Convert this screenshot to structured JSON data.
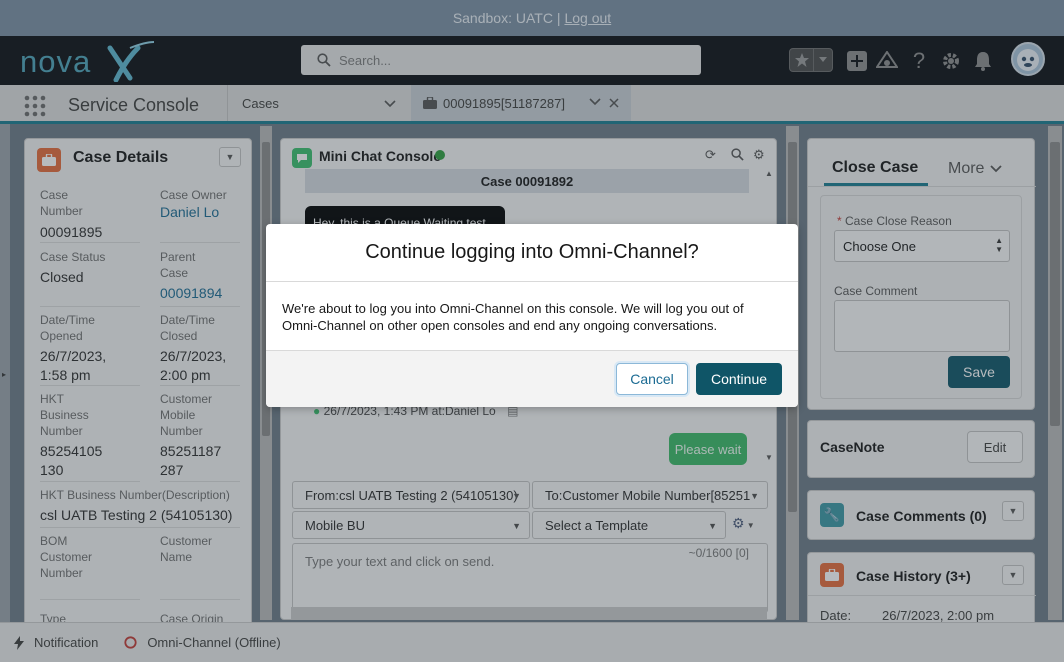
{
  "sandbox": {
    "text": "Sandbox: UATC |",
    "logout": "Log out"
  },
  "brand": {
    "logo_text": "novaX",
    "accent": "#1a7b90"
  },
  "search": {
    "placeholder": "Search..."
  },
  "app": {
    "name": "Service Console"
  },
  "nav": {
    "object": "Cases"
  },
  "workspace_tab": {
    "label": "00091895[51187287]"
  },
  "case_details": {
    "title": "Case Details",
    "fields": [
      {
        "label": "Case Number",
        "value": "00091895"
      },
      {
        "label": "Case Owner",
        "value": "Daniel Lo"
      },
      {
        "label": "Case Status",
        "value": "Closed"
      },
      {
        "label": "Parent Case",
        "value": "00091894"
      },
      {
        "label": "Date/Time Opened",
        "value": "26/7/2023, 1:58 pm"
      },
      {
        "label": "Date/Time Closed",
        "value": "26/7/2023, 2:00 pm"
      },
      {
        "label": "HKT Business Number",
        "value": "85254105130"
      },
      {
        "label": "Customer Mobile Number",
        "value": "85251187287"
      },
      {
        "label": "HKT Business Number(Description)",
        "value": "csl UATB Testing 2 (54105130)"
      },
      {
        "label": "BOM Customer Number",
        "value": ""
      },
      {
        "label": "Customer Name",
        "value": ""
      },
      {
        "label": "Type",
        "value": ""
      },
      {
        "label": "Case Origin",
        "value": ""
      }
    ]
  },
  "chat": {
    "title": "Mini Chat Console",
    "case_header": "Case 00091892",
    "msg_queue": "Hey, this is a Queue Waiting test",
    "msg_meta": "26/7/2023, 1:43 PM at:Daniel Lo",
    "msg_wait": "Please wait",
    "from": "From:csl UATB Testing 2 (54105130)",
    "to": "To:Customer Mobile Number[85251",
    "bu": "Mobile BU",
    "template": "Select a Template",
    "placeholder": "Type your text and click on send.",
    "counter": "~0/1600 [0]"
  },
  "close_case": {
    "tab_active": "Close Case",
    "tab_more": "More",
    "reason_label": "Case Close Reason",
    "reason_value": "Choose One",
    "comment_label": "Case Comment",
    "save": "Save"
  },
  "case_note": {
    "title": "CaseNote",
    "edit": "Edit"
  },
  "case_comments": {
    "title": "Case Comments (0)"
  },
  "case_history": {
    "title": "Case History (3+)",
    "date_label": "Date:",
    "date_value": "26/7/2023, 2:00 pm"
  },
  "footer": {
    "notification": "Notification",
    "omni": "Omni-Channel (Offline)"
  },
  "modal": {
    "title": "Continue logging into Omni-Channel?",
    "body": "We're about to log you into Omni-Channel on this console. We will log you out of Omni-Channel on other open consoles and end any ongoing conversations.",
    "cancel": "Cancel",
    "continue": "Continue"
  }
}
